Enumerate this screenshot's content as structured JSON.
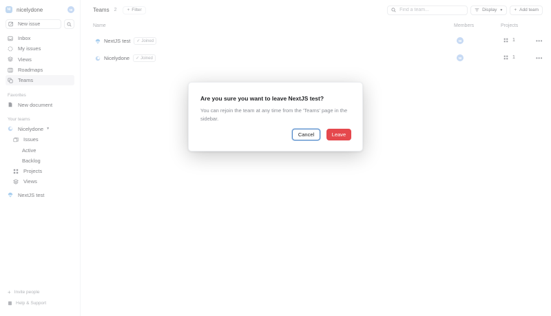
{
  "workspace": {
    "name": "nicelydone",
    "logo_initials": "NI",
    "avatar_initials": "NI"
  },
  "sidebar": {
    "new_issue_label": "New issue",
    "nav": [
      {
        "label": "Inbox",
        "icon": "inbox-icon"
      },
      {
        "label": "My issues",
        "icon": "my-issues-icon"
      },
      {
        "label": "Views",
        "icon": "views-icon"
      },
      {
        "label": "Roadmaps",
        "icon": "roadmaps-icon"
      },
      {
        "label": "Teams",
        "icon": "teams-icon",
        "active": true
      }
    ],
    "favorites_label": "Favorites",
    "favorites": [
      {
        "label": "New document",
        "icon": "document-icon"
      }
    ],
    "your_teams_label": "Your teams",
    "team": {
      "name": "Nicelydone",
      "items": [
        {
          "label": "Issues"
        },
        {
          "label": "Active"
        },
        {
          "label": "Backlog"
        },
        {
          "label": "Projects"
        },
        {
          "label": "Views"
        }
      ]
    },
    "other_team": "NextJS test",
    "invite_label": "Invite people",
    "help_label": "Help & Support"
  },
  "header": {
    "title": "Teams",
    "count": "2",
    "filter_label": "Filter",
    "search_placeholder": "Find a team...",
    "display_label": "Display",
    "add_team_label": "Add team"
  },
  "table": {
    "columns": {
      "name": "Name",
      "members": "Members",
      "projects": "Projects"
    },
    "rows": [
      {
        "name": "NextJS test",
        "status": "Joined",
        "member_initials": "NI",
        "projects": "1"
      },
      {
        "name": "Nicelydone",
        "status": "Joined",
        "member_initials": "NI",
        "projects": "1"
      }
    ]
  },
  "dialog": {
    "title": "Are you sure you want to leave NextJS test?",
    "body": "You can rejoin the team at any time from the 'Teams' page in the sidebar.",
    "cancel_label": "Cancel",
    "leave_label": "Leave"
  },
  "colors": {
    "accent": "#e5484d",
    "focus": "#4f86c6",
    "avatar": "#a9c6ee"
  }
}
